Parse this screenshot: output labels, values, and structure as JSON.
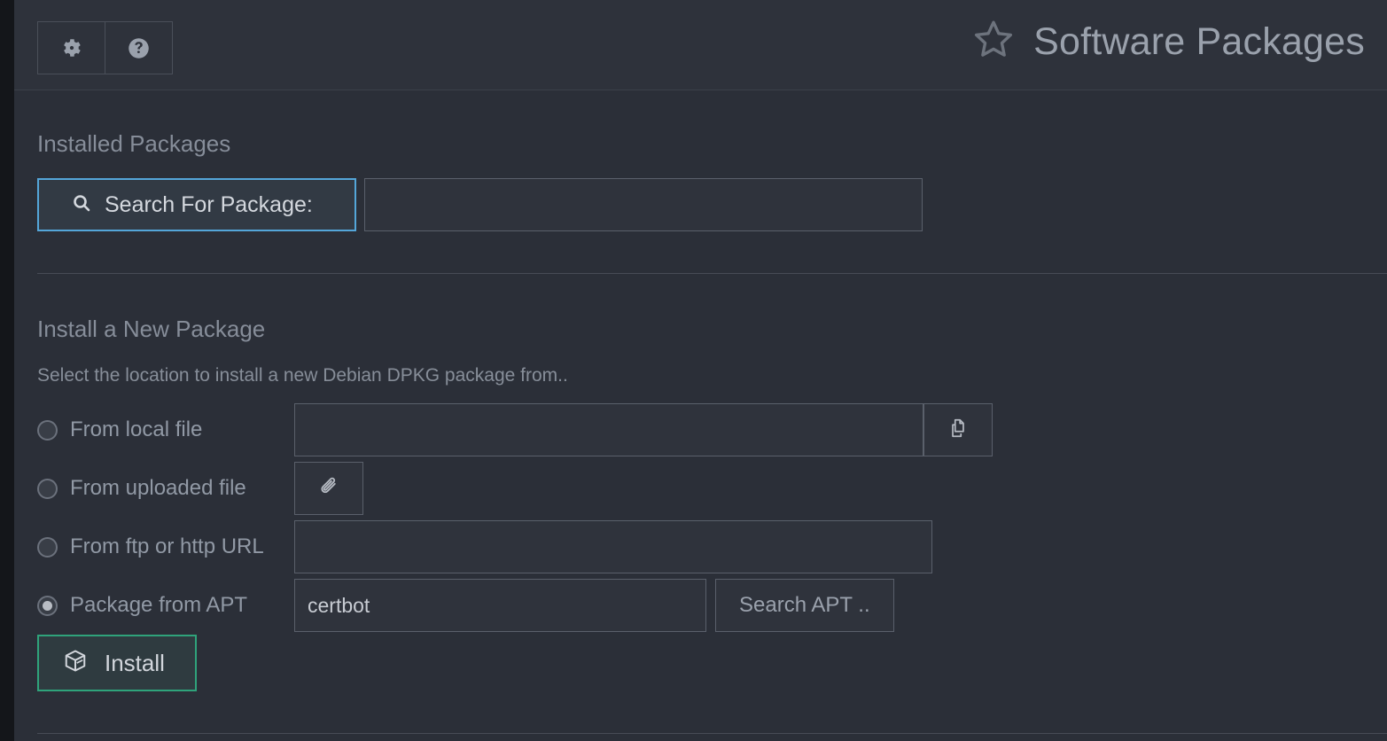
{
  "header": {
    "title": "Software Packages",
    "star_icon": "star-outline-icon",
    "buttons": [
      {
        "name": "settings",
        "icon": "gear-icon"
      },
      {
        "name": "help",
        "icon": "question-circle-icon"
      }
    ]
  },
  "installed": {
    "heading": "Installed Packages",
    "search_button_label": "Search For Package:",
    "search_icon": "magnifier-icon",
    "search_value": "",
    "search_placeholder": ""
  },
  "install_new": {
    "heading": "Install a New Package",
    "description": "Select the location to install a new Debian DPKG package from..",
    "options": [
      {
        "id": "local",
        "label": "From local file",
        "selected": false,
        "input_value": "",
        "button_icon": "copy-files-icon"
      },
      {
        "id": "upload",
        "label": "From uploaded file",
        "selected": false,
        "button_icon": "paperclip-icon"
      },
      {
        "id": "url",
        "label": "From ftp or http URL",
        "selected": false,
        "input_value": ""
      },
      {
        "id": "apt",
        "label": "Package from APT",
        "selected": true,
        "input_value": "certbot",
        "button_label": "Search APT .."
      }
    ],
    "install_button_label": "Install",
    "install_button_icon": "package-box-icon"
  },
  "colors": {
    "page_background": "#14161a",
    "panel_background": "#2b2f38",
    "header_background": "#2e323b",
    "accent_blue": "#54a6d9",
    "accent_green": "#2fa37b",
    "text_muted": "#9199a5",
    "text_bright": "#d4d8de",
    "border": "#5a606b"
  }
}
